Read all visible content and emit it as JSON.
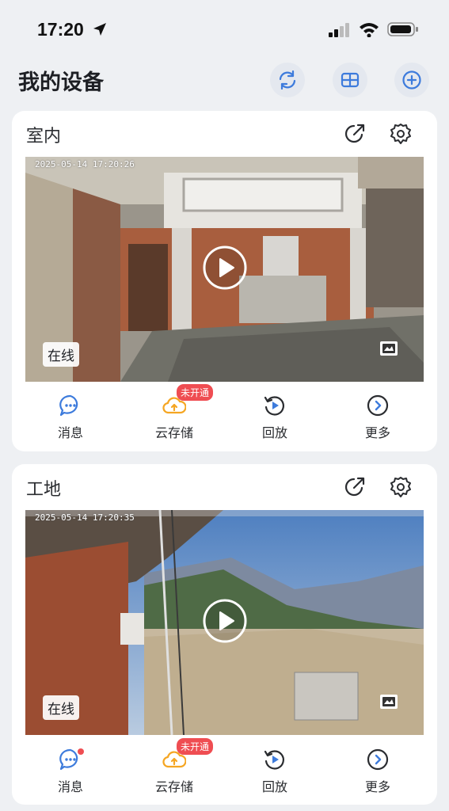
{
  "status_bar": {
    "time": "17:20"
  },
  "header": {
    "title": "我的设备"
  },
  "devices": [
    {
      "name": "室内",
      "timestamp": "2025-05-14 17:20:26",
      "status": "在线",
      "actions": [
        {
          "label": "消息"
        },
        {
          "label": "云存储",
          "badge": "未开通"
        },
        {
          "label": "回放"
        },
        {
          "label": "更多"
        }
      ]
    },
    {
      "name": "工地",
      "timestamp": "2025-05-14 17:20:35",
      "status": "在线",
      "actions": [
        {
          "label": "消息",
          "unread_dot": true
        },
        {
          "label": "云存储",
          "badge": "未开通"
        },
        {
          "label": "回放"
        },
        {
          "label": "更多"
        }
      ]
    }
  ],
  "colors": {
    "accent": "#3d7bdc",
    "warning": "#f5a623",
    "badge": "#ef4d52",
    "background": "#eef0f3"
  }
}
